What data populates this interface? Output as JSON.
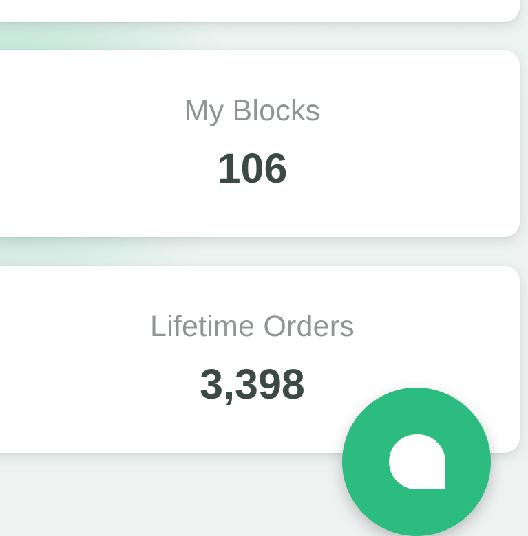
{
  "stats": [
    {
      "label": "My Blocks",
      "value": "106"
    },
    {
      "label": "Lifetime Orders",
      "value": "3,398"
    }
  ],
  "fab": {
    "icon": "chat-bubble-icon",
    "color": "#2dbc80"
  },
  "colors": {
    "label": "#8f9593",
    "value": "#3b4a44",
    "accent": "#2dbc80"
  }
}
